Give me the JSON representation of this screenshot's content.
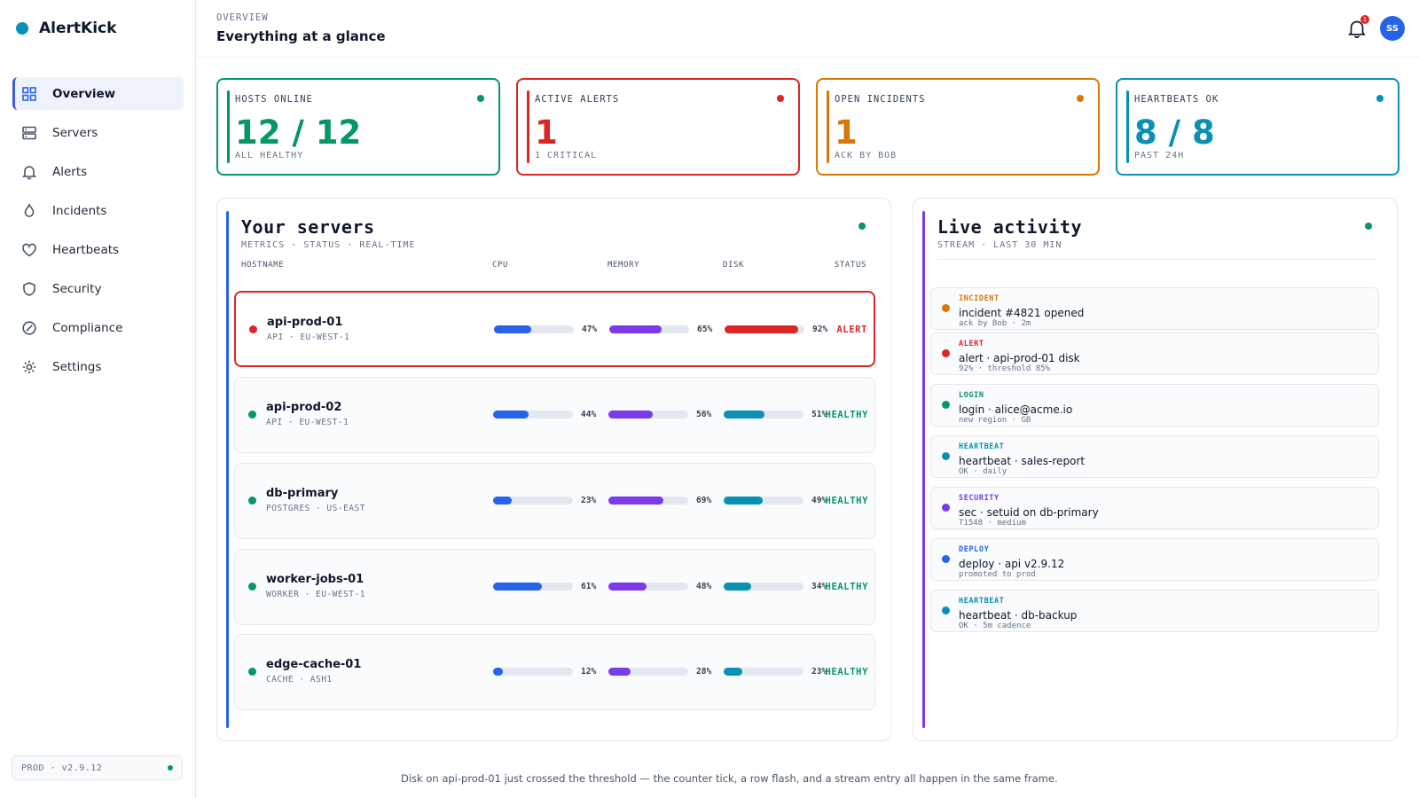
{
  "brand": {
    "name": "AlertKick",
    "color": "#0891b2"
  },
  "sidebar": {
    "items": [
      {
        "label": "Overview",
        "icon": "grid-icon",
        "active": true
      },
      {
        "label": "Servers",
        "icon": "server-icon"
      },
      {
        "label": "Alerts",
        "icon": "bell-icon"
      },
      {
        "label": "Incidents",
        "icon": "flame-icon"
      },
      {
        "label": "Heartbeats",
        "icon": "heart-icon"
      },
      {
        "label": "Security",
        "icon": "shield-icon"
      },
      {
        "label": "Compliance",
        "icon": "badge-check-icon"
      },
      {
        "label": "Settings",
        "icon": "gear-icon"
      }
    ],
    "env": "PROD · v2.9.12"
  },
  "header": {
    "eyebrow": "OVERVIEW",
    "title": "Everything at a glance",
    "notifications": "1",
    "avatar": "SS"
  },
  "stats": [
    {
      "label": "HOSTS ONLINE",
      "value": "12 / 12",
      "sub": "ALL HEALTHY",
      "color": "#059669"
    },
    {
      "label": "ACTIVE ALERTS",
      "value": "1",
      "sub": "1 CRITICAL",
      "color": "#dc2626"
    },
    {
      "label": "OPEN INCIDENTS",
      "value": "1",
      "sub": "ACK BY BOB",
      "color": "#d97706"
    },
    {
      "label": "HEARTBEATS OK",
      "value": "8 / 8",
      "sub": "PAST 24H",
      "color": "#0891b2"
    }
  ],
  "servers": {
    "title": "Your servers",
    "subtitle": "METRICS · STATUS · REAL-TIME",
    "columns": {
      "hostname": "HOSTNAME",
      "cpu": "CPU",
      "memory": "MEMORY",
      "disk": "DISK",
      "status": "STATUS"
    },
    "rows": [
      {
        "host": "api-prod-01",
        "meta": "API · EU-WEST-1",
        "cpu": 47,
        "cpu_label": "47%",
        "mem": 65,
        "mem_label": "65%",
        "disk": 92,
        "disk_label": "92%",
        "status": "ALERT",
        "alert": true
      },
      {
        "host": "api-prod-02",
        "meta": "API · EU-WEST-1",
        "cpu": 44,
        "cpu_label": "44%",
        "mem": 56,
        "mem_label": "56%",
        "disk": 51,
        "disk_label": "51%",
        "status": "HEALTHY",
        "alert": false
      },
      {
        "host": "db-primary",
        "meta": "POSTGRES · US-EAST",
        "cpu": 23,
        "cpu_label": "23%",
        "mem": 69,
        "mem_label": "69%",
        "disk": 49,
        "disk_label": "49%",
        "status": "HEALTHY",
        "alert": false
      },
      {
        "host": "worker-jobs-01",
        "meta": "WORKER · EU-WEST-1",
        "cpu": 61,
        "cpu_label": "61%",
        "mem": 48,
        "mem_label": "48%",
        "disk": 34,
        "disk_label": "34%",
        "status": "HEALTHY",
        "alert": false
      },
      {
        "host": "edge-cache-01",
        "meta": "CACHE · ASH1",
        "cpu": 12,
        "cpu_label": "12%",
        "mem": 28,
        "mem_label": "28%",
        "disk": 23,
        "disk_label": "23%",
        "status": "HEALTHY",
        "alert": false
      }
    ]
  },
  "activity": {
    "title": "Live activity",
    "subtitle": "STREAM · LAST 30 MIN",
    "events": [
      {
        "type": "INCIDENT",
        "title": "incident #4821 opened",
        "meta": "ack by Bob · 2m",
        "color": "#d97706"
      },
      {
        "type": "ALERT",
        "title": "alert · api-prod-01 disk",
        "meta": "92% · threshold 85%",
        "color": "#dc2626"
      },
      {
        "type": "LOGIN",
        "title": "login · alice@acme.io",
        "meta": "new region · GB",
        "color": "#059669"
      },
      {
        "type": "HEARTBEAT",
        "title": "heartbeat · sales-report",
        "meta": "OK · daily",
        "color": "#0891b2"
      },
      {
        "type": "SECURITY",
        "title": "sec · setuid on db-primary",
        "meta": "T1548 · medium",
        "color": "#7c3aed"
      },
      {
        "type": "DEPLOY",
        "title": "deploy · api v2.9.12",
        "meta": "promoted to prod",
        "color": "#2563eb"
      },
      {
        "type": "HEARTBEAT",
        "title": "heartbeat · db-backup",
        "meta": "OK · 5m cadence",
        "color": "#0891b2"
      }
    ]
  },
  "footnote": "Disk on api-prod-01 just crossed the threshold — the counter tick, a row flash, and a stream entry all happen in the same frame.",
  "colors": {
    "cpu": "#2563eb",
    "memory": "#7c3aed",
    "disk": "#0891b2",
    "disk_alert": "#dc2626",
    "healthy": "#059669",
    "alert": "#dc2626",
    "servers_accent": "#2563eb",
    "activity_accent": "#7c3aed"
  }
}
